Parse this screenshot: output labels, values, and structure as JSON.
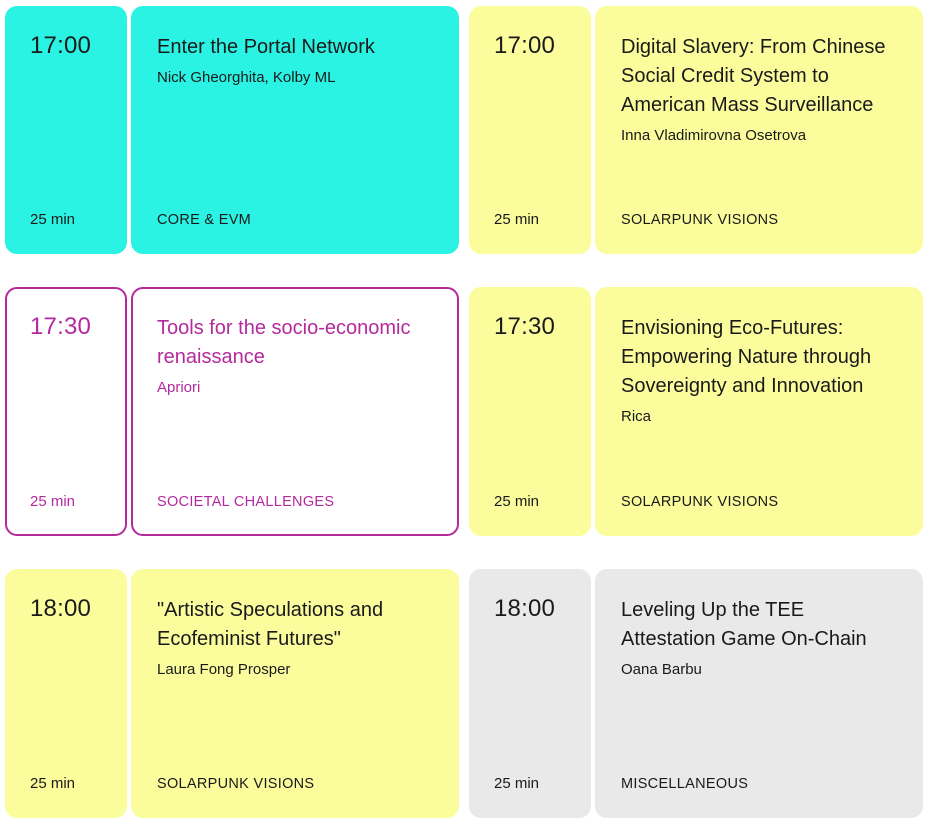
{
  "sessions": [
    {
      "time": "17:00",
      "duration": "25 min",
      "title": "Enter the Portal Network",
      "speakers": "Nick Gheorghita, Kolby ML",
      "track": "CORE & EVM",
      "theme": "cyan",
      "theme_color": "#2af3e3"
    },
    {
      "time": "17:00",
      "duration": "25 min",
      "title": "Digital Slavery: From Chinese Social Credit System to American Mass Surveillance",
      "speakers": "Inna Vladimirovna Osetrova",
      "track": "SOLARPUNK VISIONS",
      "theme": "yellow",
      "theme_color": "#fbfd9d"
    },
    {
      "time": "17:30",
      "duration": "25 min",
      "title": "Tools for the socio-economic renaissance",
      "speakers": "Apriori",
      "track": "SOCIETAL CHALLENGES",
      "theme": "outline",
      "theme_color": "#b42a9e"
    },
    {
      "time": "17:30",
      "duration": "25 min",
      "title": "Envisioning Eco-Futures: Empowering Nature through Sovereignty and Innovation",
      "speakers": "Rica",
      "track": "SOLARPUNK VISIONS",
      "theme": "yellow",
      "theme_color": "#fbfd9d"
    },
    {
      "time": "18:00",
      "duration": "25 min",
      "title": "\"Artistic Speculations and Ecofeminist Futures\"",
      "speakers": "Laura Fong Prosper",
      "track": "SOLARPUNK VISIONS",
      "theme": "yellow",
      "theme_color": "#fbfd9d"
    },
    {
      "time": "18:00",
      "duration": "25 min",
      "title": "Leveling Up the TEE Attestation Game On-Chain",
      "speakers": "Oana Barbu",
      "track": "MISCELLANEOUS",
      "theme": "grey",
      "theme_color": "#e9e9e9"
    }
  ]
}
